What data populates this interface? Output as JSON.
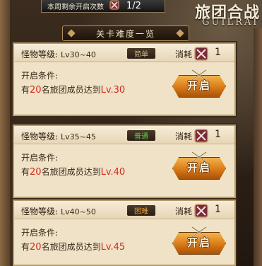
{
  "counter": {
    "label": "本周剩余开启次数",
    "value": "1/2"
  },
  "guild": {
    "title": "旅团合战",
    "subtitle": "GUILRAI"
  },
  "panel": {
    "title": "关卡难度一览"
  },
  "levels": [
    {
      "monster_label": "怪物等级:",
      "monster_range": "Lv30~40",
      "difficulty": "简单",
      "difficulty_color": "#c9b48a",
      "cost_label": "消耗",
      "cost_value": "1",
      "condition_title": "开启条件:",
      "cond_prefix": "有",
      "cond_count": "20",
      "cond_middle": "名旅团成员达到",
      "cond_level": "Lv.30",
      "button_label": "开启"
    },
    {
      "monster_label": "怪物等级:",
      "monster_range": "Lv35~45",
      "difficulty": "普通",
      "difficulty_color": "#5fd04a",
      "cost_label": "消耗",
      "cost_value": "1",
      "condition_title": "开启条件:",
      "cond_prefix": "有",
      "cond_count": "20",
      "cond_middle": "名旅团成员达到",
      "cond_level": "Lv.40",
      "button_label": "开启"
    },
    {
      "monster_label": "怪物等级:",
      "monster_range": "Lv40~50",
      "difficulty": "困难",
      "difficulty_color": "#e8a030",
      "cost_label": "消耗",
      "cost_value": "1",
      "condition_title": "开启条件:",
      "cond_prefix": "有",
      "cond_count": "20",
      "cond_middle": "名旅团成员达到",
      "cond_level": "Lv.45",
      "button_label": "开启"
    }
  ],
  "colors": {
    "highlight": "#d42a1a",
    "button": "#d97a18",
    "card": "#efe2c7"
  }
}
